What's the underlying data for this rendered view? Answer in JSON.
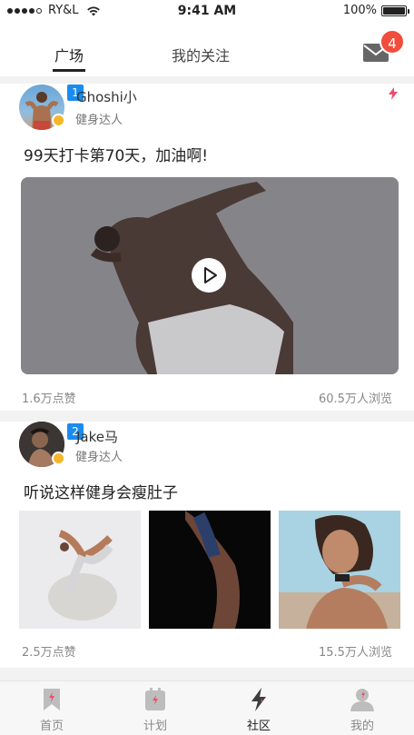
{
  "status_bar": {
    "carrier": "RY&L",
    "time": "9:41 AM",
    "battery": "100%",
    "signal_dots": 5,
    "signal_filled": 4
  },
  "tabs": {
    "active": "广场",
    "inactive": "我的关注",
    "mail_badge": "4"
  },
  "posts": [
    {
      "rank": "1",
      "username": "Ghoshi小",
      "subtitle": "健身达人",
      "text": "99天打卡第70天，加油啊!",
      "media": "video",
      "likes": "1.6万点赞",
      "views": "60.5万人浏览"
    },
    {
      "rank": "2",
      "username": "Jake马",
      "subtitle": "健身达人",
      "text": "听说这样健身会瘦肚子",
      "media": "images",
      "likes": "2.5万点赞",
      "views": "15.5万人浏览"
    }
  ],
  "bottom_nav": [
    {
      "label": "首页",
      "icon": "bookmark-icon"
    },
    {
      "label": "计划",
      "icon": "calendar-icon"
    },
    {
      "label": "社区",
      "icon": "lightning-icon"
    },
    {
      "label": "我的",
      "icon": "person-icon"
    }
  ],
  "colors": {
    "accent": "#f04d3c",
    "badge_blue": "#1a8cf0",
    "vip_gold": "#f5b72a"
  }
}
